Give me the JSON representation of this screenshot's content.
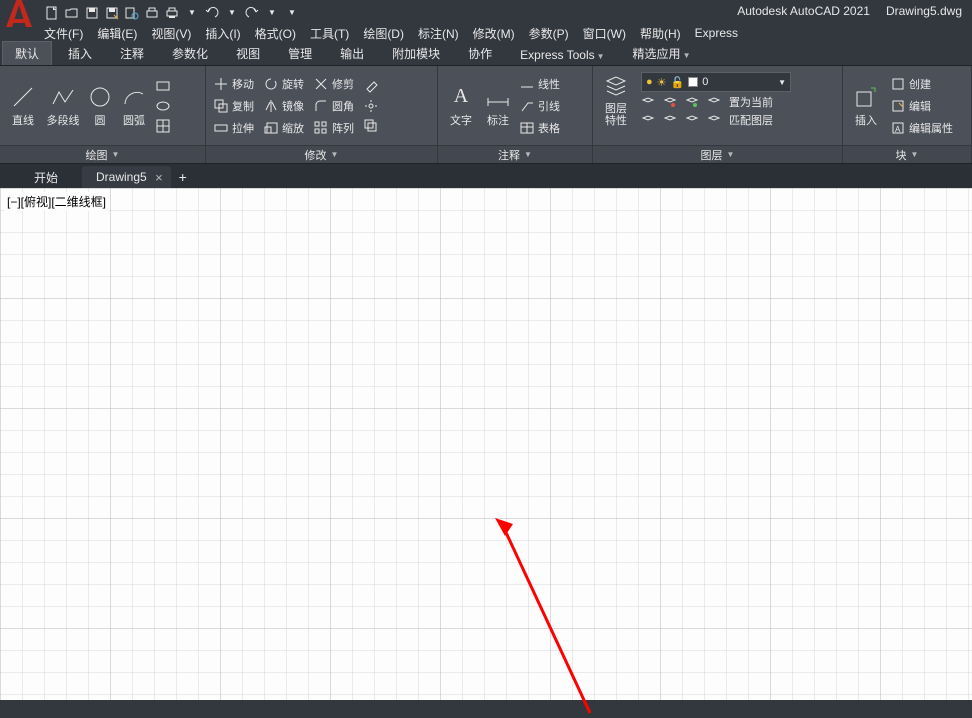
{
  "app": {
    "name": "Autodesk AutoCAD 2021",
    "doc": "Drawing5.dwg"
  },
  "menu": [
    "文件(F)",
    "编辑(E)",
    "视图(V)",
    "插入(I)",
    "格式(O)",
    "工具(T)",
    "绘图(D)",
    "标注(N)",
    "修改(M)",
    "参数(P)",
    "窗口(W)",
    "帮助(H)",
    "Express"
  ],
  "ribbon_tabs": [
    "默认",
    "插入",
    "注释",
    "参数化",
    "视图",
    "管理",
    "输出",
    "附加模块",
    "协作",
    "Express Tools",
    "精选应用"
  ],
  "active_ribbon_tab": "默认",
  "draw": {
    "panel": "绘图",
    "line": "直线",
    "pline": "多段线",
    "circle": "圆",
    "arc": "圆弧"
  },
  "modify": {
    "panel": "修改",
    "move": "移动",
    "rotate": "旋转",
    "trim": "修剪",
    "copy": "复制",
    "mirror": "镜像",
    "fillet": "圆角",
    "stretch": "拉伸",
    "scale": "缩放",
    "array": "阵列"
  },
  "annotate": {
    "panel": "注释",
    "text": "文字",
    "dim": "标注",
    "leader": "线性",
    "mleader": "引线",
    "table": "表格"
  },
  "layer": {
    "panel": "图层",
    "props": "图层\n特性",
    "current": "0",
    "setcur": "置为当前",
    "match": "匹配图层"
  },
  "block": {
    "panel": "块",
    "insert": "插入",
    "create": "创建",
    "edit": "编辑",
    "attr": "编辑属性"
  },
  "doc_tabs": {
    "start": "开始",
    "drawing": "Drawing5"
  },
  "viewport": "[−][俯视][二维线框]"
}
